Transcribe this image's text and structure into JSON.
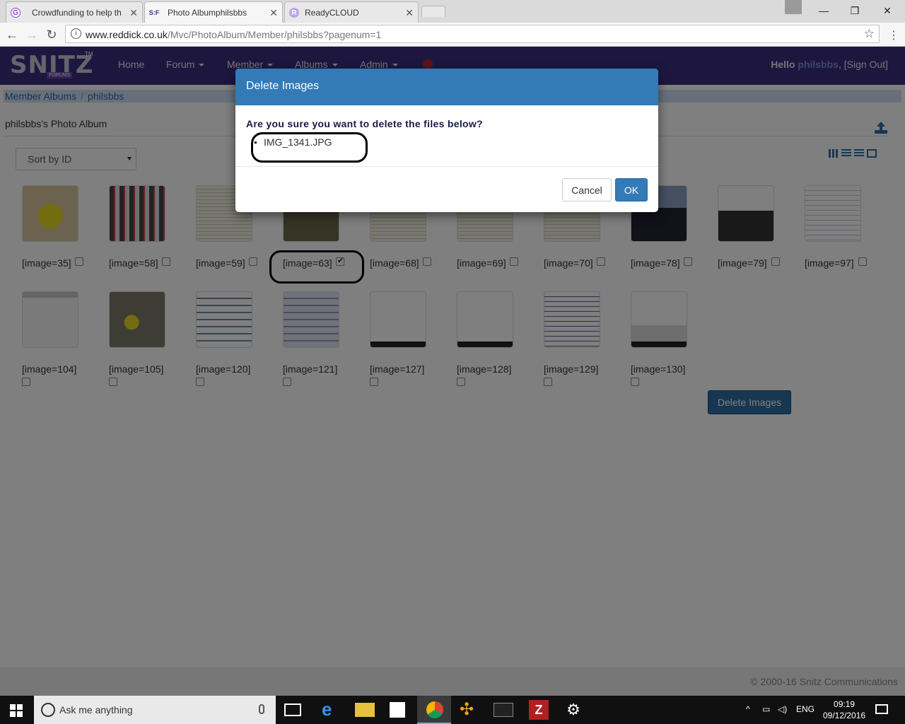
{
  "browser": {
    "tabs": [
      {
        "title": "Crowdfunding to help th",
        "favicon": "G",
        "favicon_color": "#9c3ad8"
      },
      {
        "title": "Photo Albumphilsbbs",
        "favicon": "S:F",
        "favicon_color": "#3b2f80"
      },
      {
        "title": "ReadyCLOUD",
        "favicon": "R",
        "favicon_color": "#7a6ad0"
      }
    ],
    "url_host": "www.reddick.co.uk",
    "url_path": "/Mvc/PhotoAlbum/Member/philsbbs?pagenum=1"
  },
  "site": {
    "logo_text": "SNITZ",
    "logo_sub": "FORUMS",
    "logo_tm": "TM",
    "nav": [
      "Home",
      "Forum",
      "Member",
      "Albums",
      "Admin"
    ],
    "hello_prefix": "Hello ",
    "username": "philsbbs",
    "signout": ", [Sign Out]"
  },
  "breadcrumb": [
    "Member Albums",
    "philsbbs"
  ],
  "album": {
    "title": "philsbbs's Photo Album",
    "sort_label": "Sort by ID",
    "delete_button": "Delete Images",
    "images": [
      {
        "caption": "[image=35]",
        "checked": false
      },
      {
        "caption": "[image=58]",
        "checked": false
      },
      {
        "caption": "[image=59]",
        "checked": false
      },
      {
        "caption": "[image=63]",
        "checked": true
      },
      {
        "caption": "[image=68]",
        "checked": false
      },
      {
        "caption": "[image=69]",
        "checked": false
      },
      {
        "caption": "[image=70]",
        "checked": false
      },
      {
        "caption": "[image=78]",
        "checked": false
      },
      {
        "caption": "[image=79]",
        "checked": false
      },
      {
        "caption": "[image=97]",
        "checked": false
      },
      {
        "caption": "[image=104]",
        "checked": false
      },
      {
        "caption": "[image=105]",
        "checked": false
      },
      {
        "caption": "[image=120]",
        "checked": false
      },
      {
        "caption": "[image=121]",
        "checked": false
      },
      {
        "caption": "[image=127]",
        "checked": false
      },
      {
        "caption": "[image=128]",
        "checked": false
      },
      {
        "caption": "[image=129]",
        "checked": false
      },
      {
        "caption": "[image=130]",
        "checked": false
      }
    ]
  },
  "modal": {
    "title": "Delete Images",
    "question": "Are you sure you want to delete the files below?",
    "files": [
      "IMG_1341.JPG"
    ],
    "cancel": "Cancel",
    "ok": "OK"
  },
  "footer": "© 2000-16 Snitz Communications",
  "taskbar": {
    "search_placeholder": "Ask me anything",
    "lang": "ENG",
    "time": "09:19",
    "date": "09/12/2016"
  },
  "colors": {
    "nav_bg": "#3b2f80",
    "modal_header": "#337ab7",
    "primary_button": "#2e6da4"
  }
}
